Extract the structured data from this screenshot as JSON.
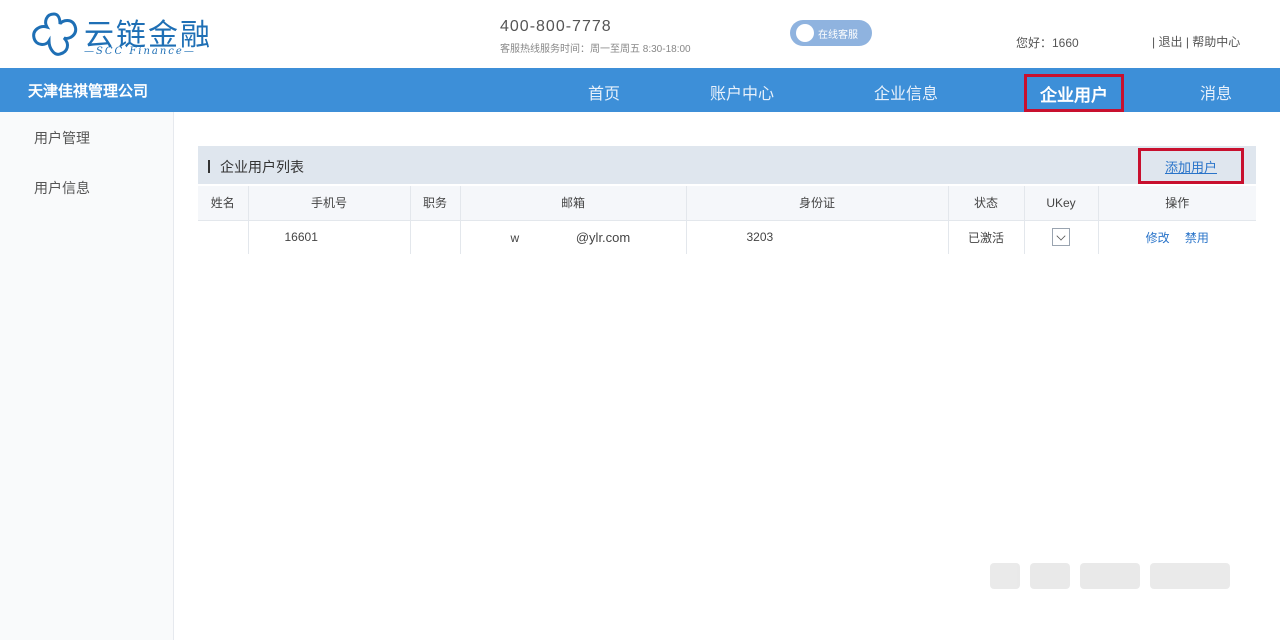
{
  "brand": {
    "name": "云链金融",
    "subtitle": "—SCC Finance—"
  },
  "contact": {
    "phone": "400-800-7778",
    "hours": "客服热线服务时间：周一至周五 8:30-18:00"
  },
  "header": {
    "online_service_label": "在线客服",
    "greeting": "您好：1660",
    "logout_label": "退出",
    "help_label": "帮助中心"
  },
  "navbar": {
    "company": "天津佳祺管理公司",
    "items": [
      "首页",
      "账户中心",
      "企业信息",
      "企业用户",
      "消息"
    ],
    "active_index": 3
  },
  "sidebar": {
    "items": [
      "用户管理",
      "用户信息"
    ]
  },
  "panel": {
    "title": "企业用户列表",
    "add_user_label": "添加用户"
  },
  "table": {
    "columns": [
      "姓名",
      "手机号",
      "职务",
      "邮箱",
      "身份证",
      "状态",
      "UKey",
      "操作"
    ],
    "rows": [
      {
        "name": "",
        "phone": "16601",
        "position": "",
        "email_prefix": "w",
        "email_domain": "@ylr.com",
        "id_card": "3203",
        "status": "已激活",
        "ukey_checked": true,
        "actions": [
          "修改",
          "禁用"
        ]
      }
    ]
  },
  "colors": {
    "nav_bg": "#3d8fd8",
    "highlight_border": "#c8102e",
    "link": "#2a74c9",
    "brand": "#1e6fb5"
  }
}
